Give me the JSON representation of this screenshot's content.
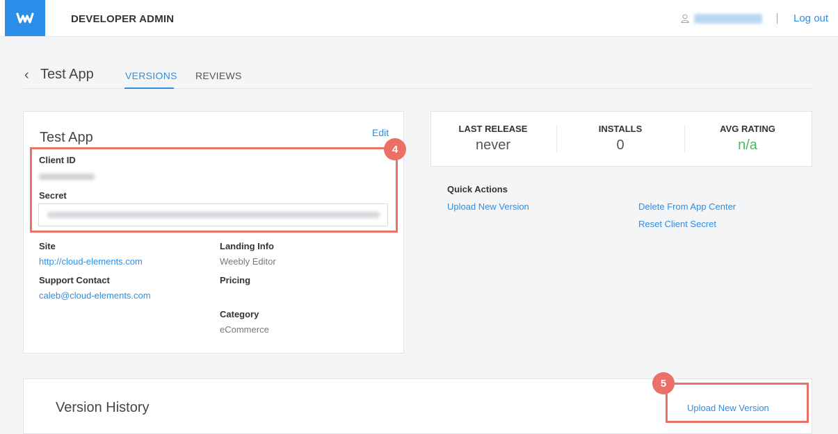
{
  "header": {
    "brand": "DEVELOPER ADMIN",
    "logout_label": "Log out"
  },
  "nav": {
    "back_glyph": "‹",
    "title": "Test App",
    "tabs": [
      {
        "label": "VERSIONS",
        "active": true
      },
      {
        "label": "REVIEWS",
        "active": false
      }
    ]
  },
  "app_card": {
    "title": "Test App",
    "edit_label": "Edit",
    "client_id_label": "Client ID",
    "secret_label": "Secret",
    "site_label": "Site",
    "site_value": "http://cloud-elements.com",
    "landing_label": "Landing Info",
    "landing_value": "Weebly Editor",
    "support_label": "Support Contact",
    "support_value": "caleb@cloud-elements.com",
    "pricing_label": "Pricing",
    "category_label": "Category",
    "category_value": "eCommerce"
  },
  "stats": {
    "last_release_label": "LAST RELEASE",
    "last_release_value": "never",
    "installs_label": "INSTALLS",
    "installs_value": "0",
    "rating_label": "AVG RATING",
    "rating_value": "n/a"
  },
  "quick_actions": {
    "title": "Quick Actions",
    "upload": "Upload New Version",
    "delete": "Delete From App Center",
    "reset": "Reset Client Secret"
  },
  "version_history": {
    "title": "Version History",
    "upload": "Upload New Version"
  },
  "annotations": {
    "step4": "4",
    "step5": "5"
  },
  "colors": {
    "accent": "#2b8ee8",
    "highlight": "#ea7068",
    "rating_green": "#49b866"
  }
}
